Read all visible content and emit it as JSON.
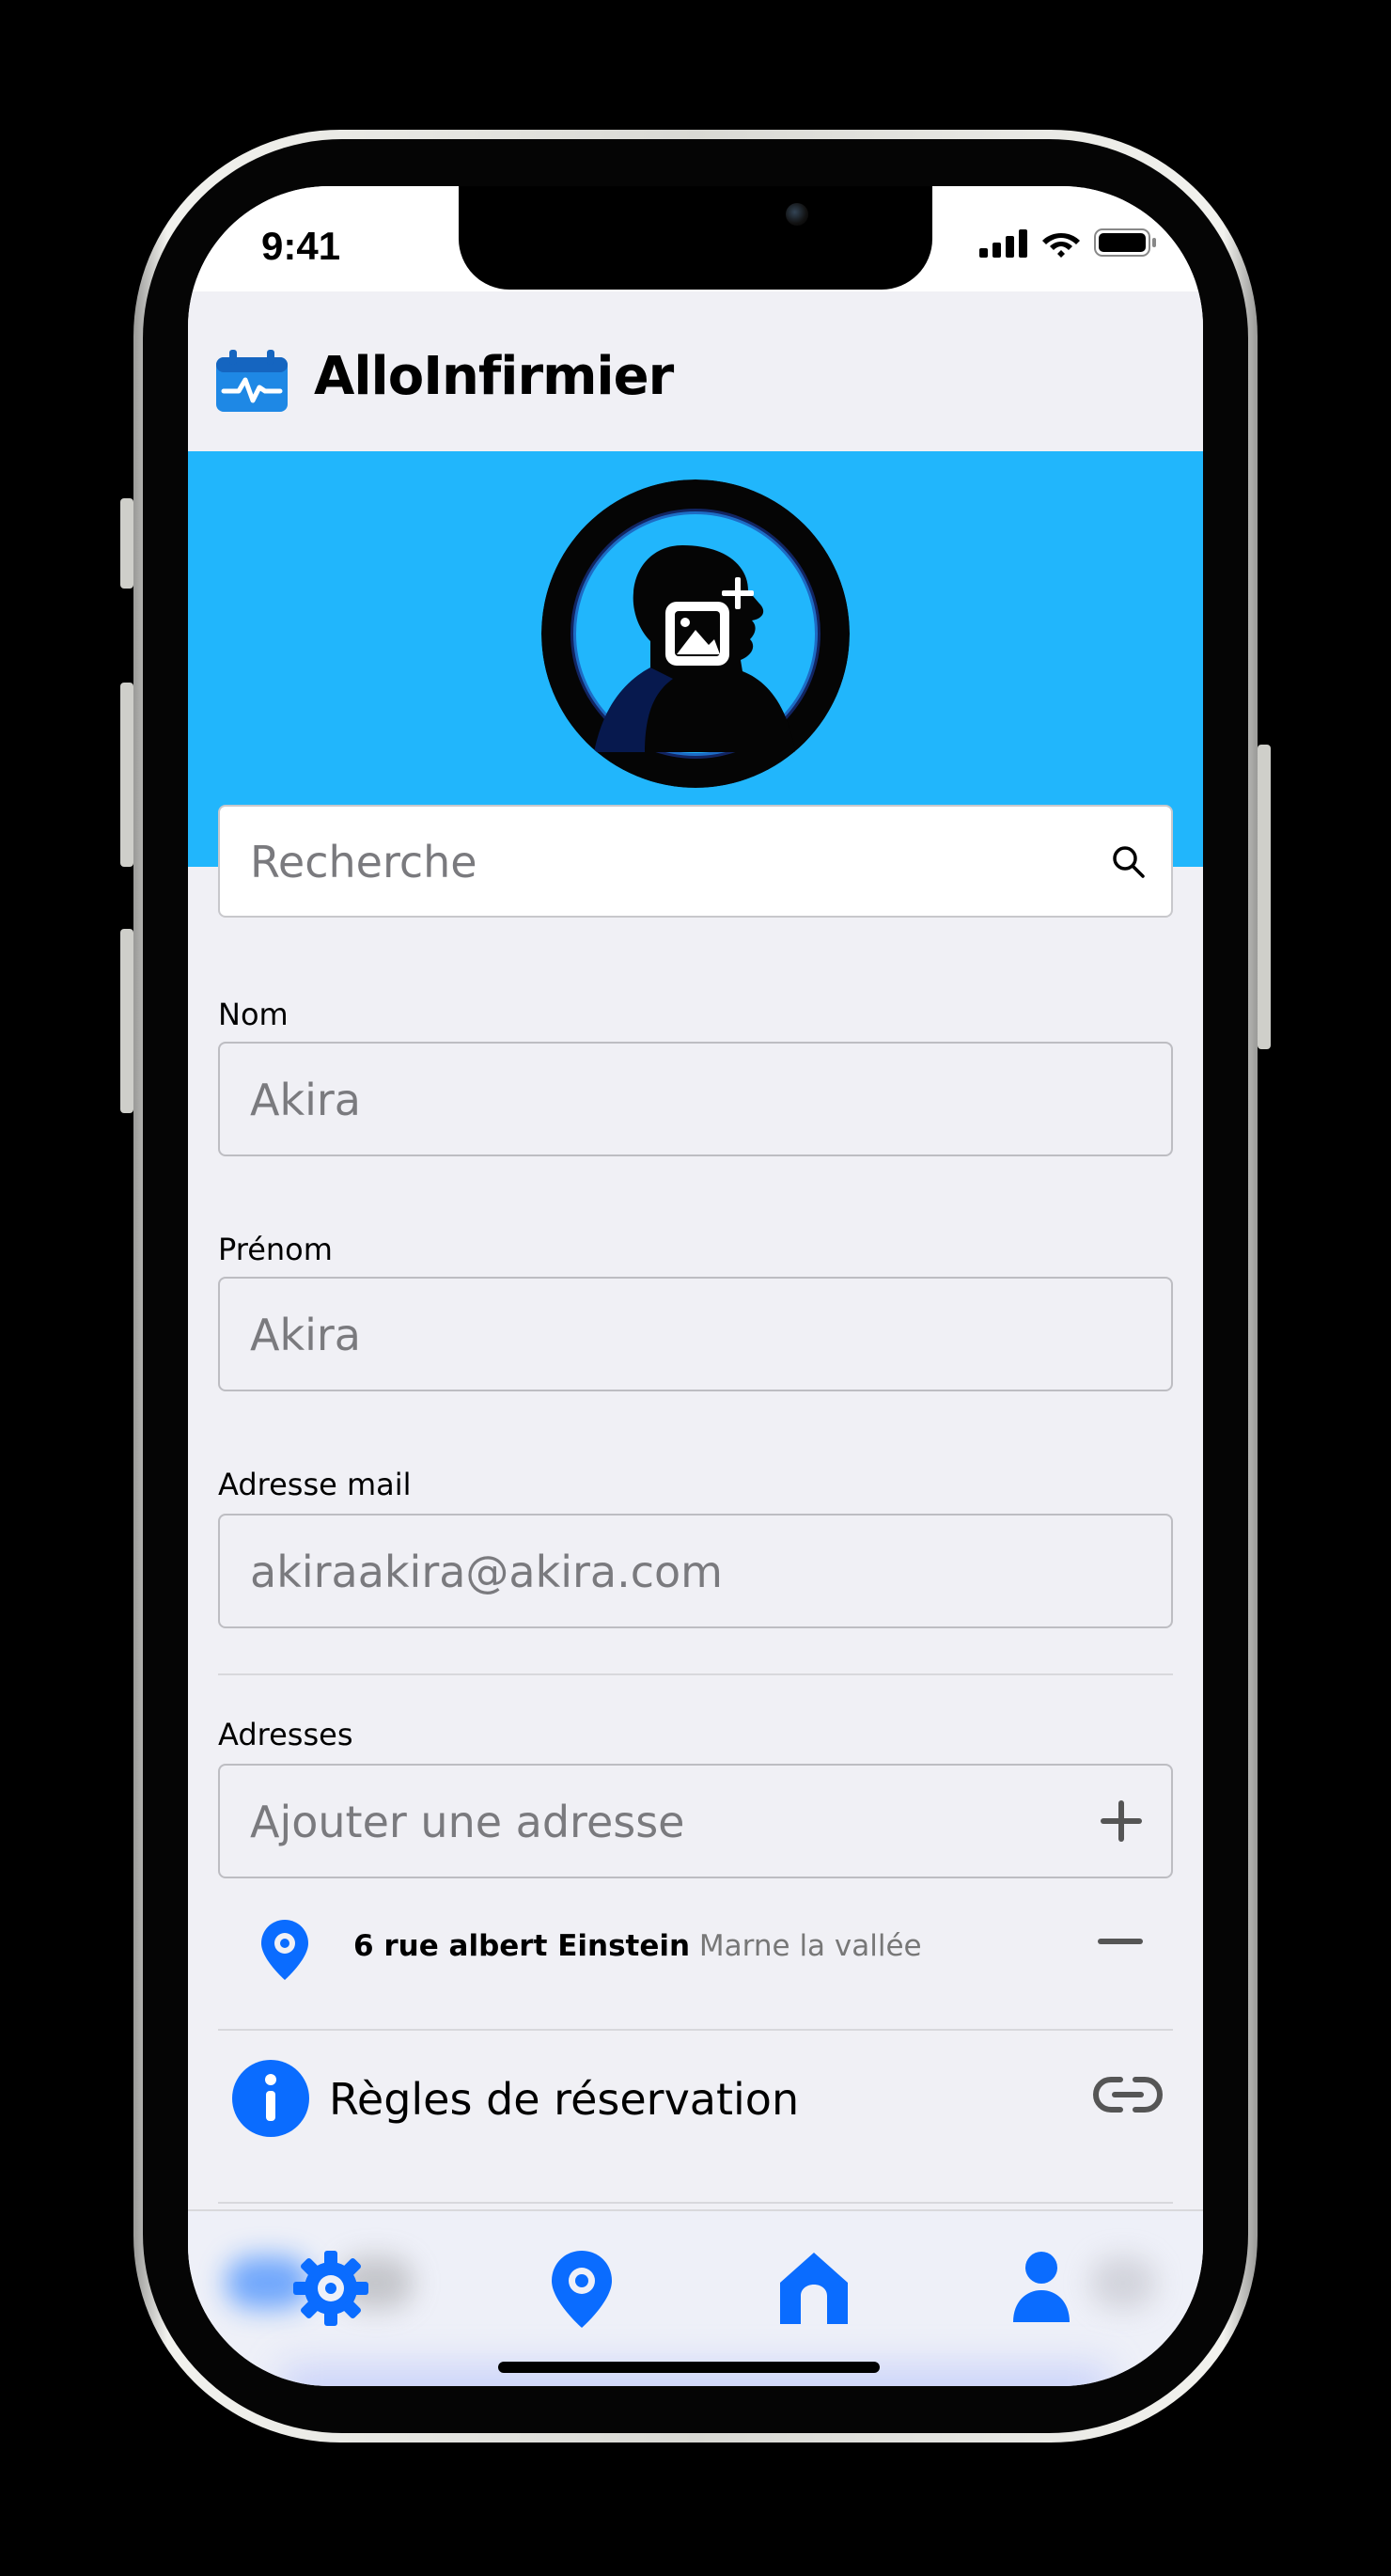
{
  "status_bar": {
    "time": "9:41"
  },
  "header": {
    "app_title": "AlloInfirmier"
  },
  "search": {
    "placeholder": "Recherche"
  },
  "form": {
    "nom": {
      "label": "Nom",
      "placeholder": "Akira"
    },
    "prenom": {
      "label": "Prénom",
      "placeholder": "Akira"
    },
    "email": {
      "label": "Adresse mail",
      "placeholder": "akiraakira@akira.com"
    },
    "adresses": {
      "label": "Adresses",
      "add_placeholder": "Ajouter une adresse",
      "items": [
        {
          "street": "6 rue albert Einstein",
          "city": "Marne la vallée"
        }
      ]
    },
    "rules": {
      "label": "Règles de réservation"
    }
  },
  "tabbar": {
    "items": [
      {
        "icon": "gear-icon"
      },
      {
        "icon": "location-pin-icon"
      },
      {
        "icon": "home-icon"
      },
      {
        "icon": "user-icon"
      }
    ]
  },
  "colors": {
    "accent": "#0a6cff",
    "banner": "#21b6fc",
    "background": "#f0f0f5"
  }
}
